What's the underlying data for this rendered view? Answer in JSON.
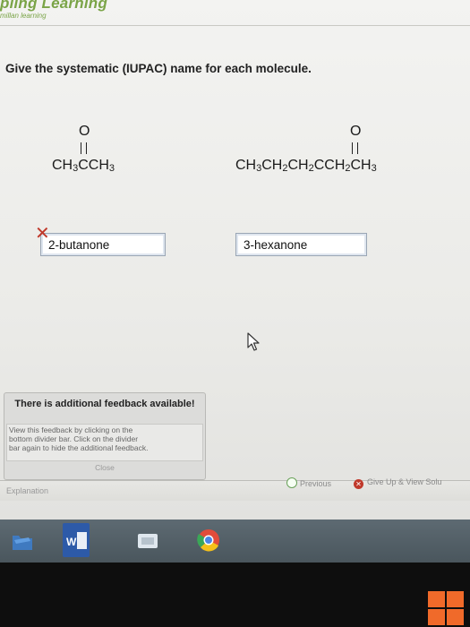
{
  "app": {
    "brand_name": "pling Learning",
    "brand_tagline": "millan learning"
  },
  "question": {
    "prompt": "Give the systematic (IUPAC) name for each molecule."
  },
  "molecules": [
    {
      "carbonyl_o": "O",
      "formula_parts": [
        "CH",
        "3",
        "CCH",
        "3"
      ]
    },
    {
      "carbonyl_o": "O",
      "formula_parts": [
        "CH",
        "3",
        "CH",
        "2",
        "CH",
        "2",
        "CCH",
        "2",
        "CH",
        "3"
      ]
    }
  ],
  "answers": [
    {
      "value": "2-butanone",
      "status": "incorrect"
    },
    {
      "value": "3-hexanone",
      "status": "none"
    }
  ],
  "feedback": {
    "title": "There is additional feedback available!",
    "body_lines": [
      "View this feedback by clicking on the",
      "bottom divider bar. Click on the divider",
      "bar again to hide the additional feedback."
    ],
    "close_label": "Close"
  },
  "bottom_bar": {
    "explanation_tab": "Explanation",
    "previous_label": "Previous",
    "give_up_label": "Give Up & View Solu"
  },
  "taskbar": {
    "word_label": "W"
  },
  "colors": {
    "brand_green": "#7aa447",
    "error_red": "#c0392b",
    "win_orange": "#f06a2a"
  }
}
